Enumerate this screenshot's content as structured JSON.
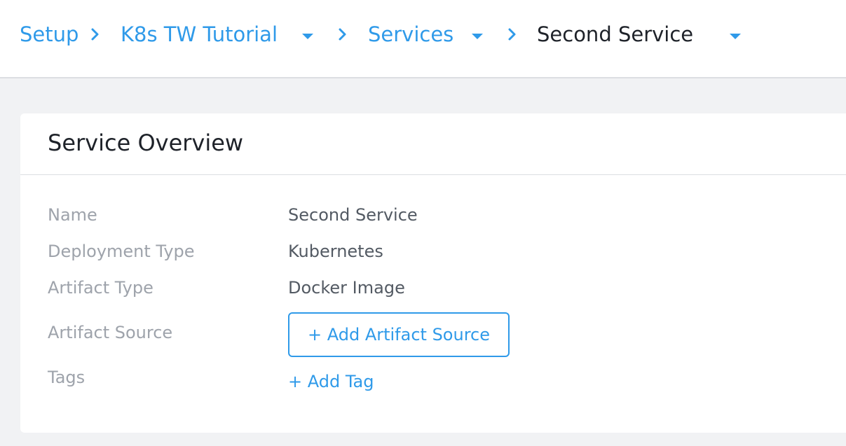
{
  "breadcrumb": {
    "items": [
      {
        "label": "Setup"
      },
      {
        "label": "K8s TW Tutorial"
      },
      {
        "label": "Services"
      },
      {
        "label": "Second Service"
      }
    ]
  },
  "colors": {
    "link": "#2f9ae9",
    "text_dark": "#1e2229",
    "label_gray": "#9ea3ab",
    "value_gray": "#535a63",
    "page_bg": "#f1f2f4"
  },
  "overview": {
    "title": "Service Overview",
    "fields": [
      {
        "label": "Name",
        "value": "Second Service"
      },
      {
        "label": "Deployment Type",
        "value": "Kubernetes"
      },
      {
        "label": "Artifact Type",
        "value": "Docker Image"
      },
      {
        "label": "Artifact Source"
      },
      {
        "label": "Tags"
      }
    ],
    "add_artifact_source_label": "+ Add Artifact Source",
    "add_tag_label": "+ Add Tag"
  },
  "icons": {
    "separator": "chevron-right-icon",
    "dropdown": "caret-down-icon"
  }
}
